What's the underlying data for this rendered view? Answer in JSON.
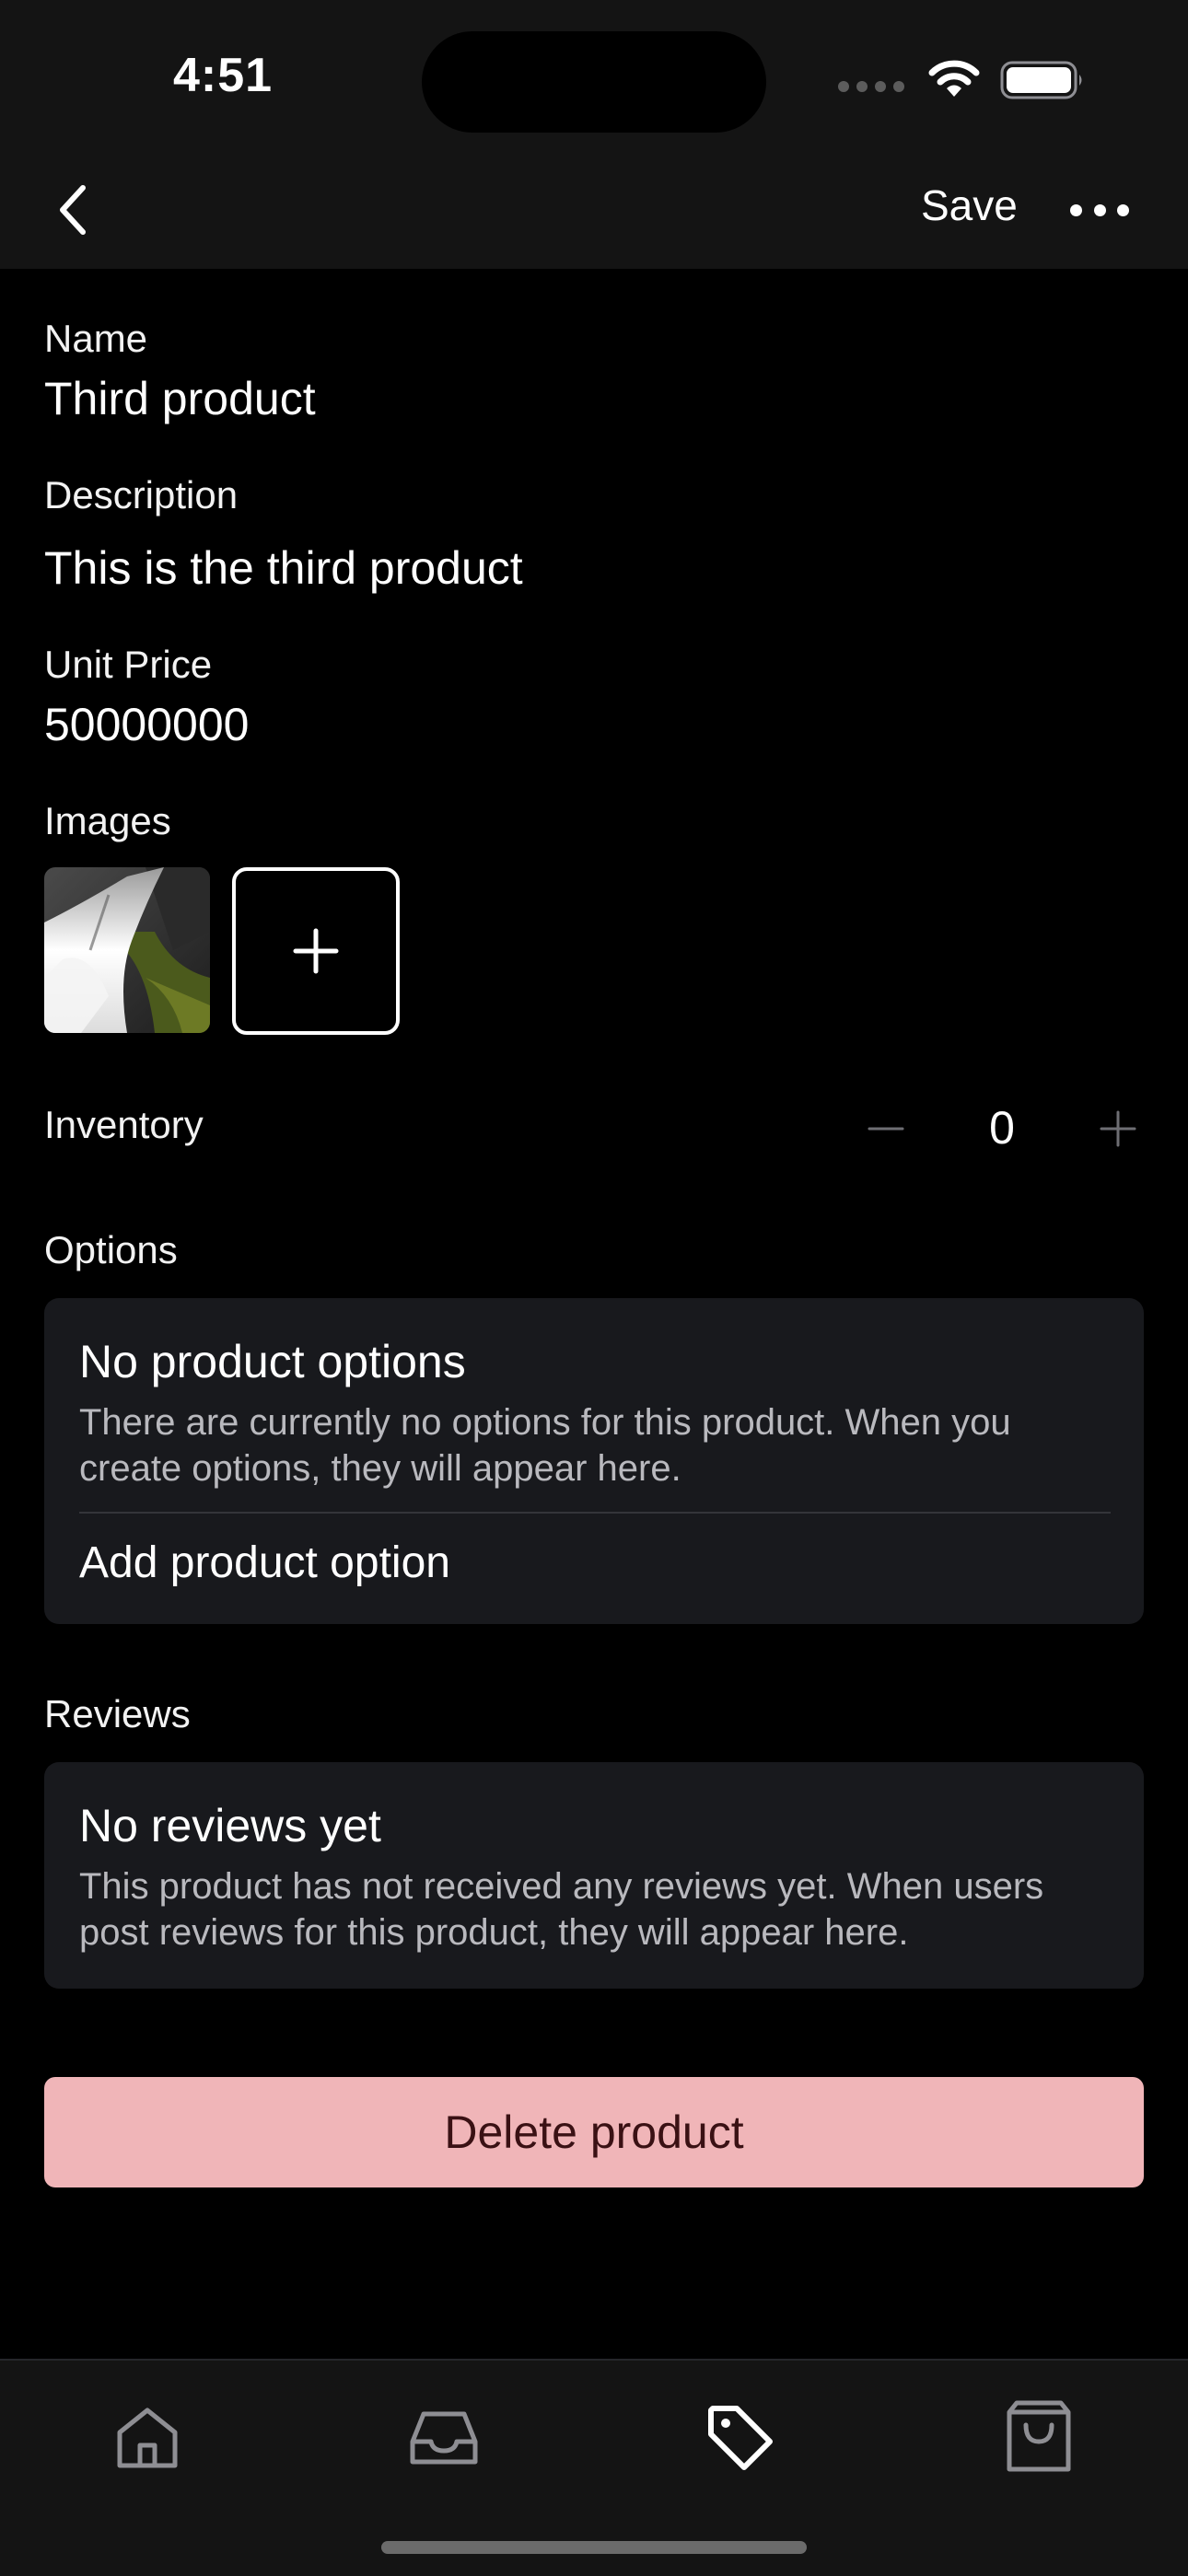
{
  "status_bar": {
    "time": "4:51"
  },
  "nav": {
    "back_icon": "chevron-left-icon",
    "save_label": "Save",
    "more_icon": "ellipsis-icon"
  },
  "form": {
    "name_label": "Name",
    "name_value": "Third product",
    "description_label": "Description",
    "description_value": "This is the third product",
    "price_label": "Unit Price",
    "price_value": "50000000",
    "images_label": "Images",
    "add_image_icon": "plus-icon",
    "inventory_label": "Inventory",
    "inventory_value": "0",
    "options_label": "Options",
    "reviews_label": "Reviews"
  },
  "options_card": {
    "title": "No product options",
    "text": "There are currently no options for this product. When you create options, they will appear here.",
    "action": "Add product option"
  },
  "reviews_card": {
    "title": "No reviews yet",
    "text": "This product has not received any reviews yet. When users post reviews for this product, they will appear here."
  },
  "delete_button": {
    "label": "Delete product",
    "background": "#f0b5b8",
    "text_color": "#3a1114"
  },
  "tabs": [
    {
      "icon": "home-icon",
      "active": false
    },
    {
      "icon": "inbox-icon",
      "active": false
    },
    {
      "icon": "tag-icon",
      "active": true
    },
    {
      "icon": "shopping-bag-icon",
      "active": false
    }
  ],
  "colors": {
    "background": "#000000",
    "bar": "#141414",
    "card": "#18191d",
    "muted_text": "#b9b9be",
    "inactive_icon": "#8e8e93"
  }
}
